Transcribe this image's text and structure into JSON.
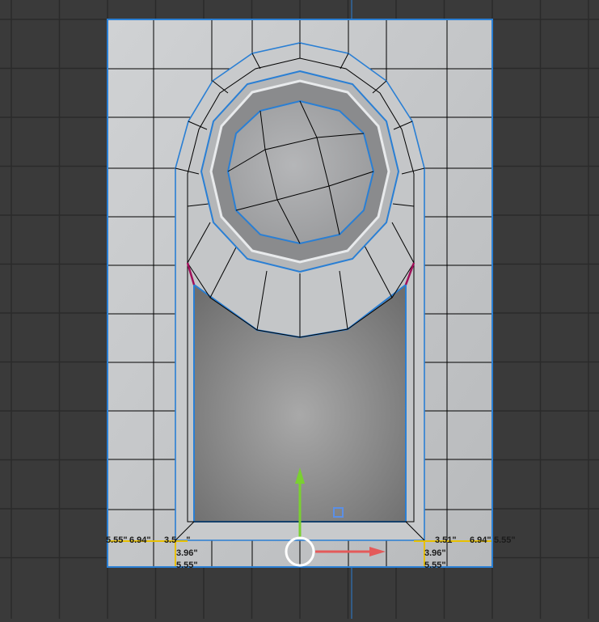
{
  "viewport": {
    "background": "#3a3a3a",
    "grid_color": "#2a2a2a",
    "axis_color": "#2f73b8"
  },
  "model": {
    "face_color": "#c4c6c8",
    "edge_color": "#000000",
    "selection_color": "#2a7fd4",
    "pole_edge_color": "#a0105a"
  },
  "gizmo": {
    "y_axis_color": "#7ad030",
    "x_axis_color": "#e45a5a",
    "plane_handle_color": "#5b8fe6",
    "center_ring_color": "#ffffff"
  },
  "dimensions": {
    "left_outer": "5.55\"",
    "left_mid": "6.94\"",
    "left_inner": "3.5",
    "left_inner_suffix": "\"",
    "left_height": "3.96\"",
    "left_bottom": "5.55\"",
    "right_inner": "3.51\"",
    "right_mid": "6.94\"",
    "right_outer": "5.55\"",
    "right_height": "3.96\"",
    "right_bottom": "5.55\"",
    "guide_color": "#e8c000"
  }
}
